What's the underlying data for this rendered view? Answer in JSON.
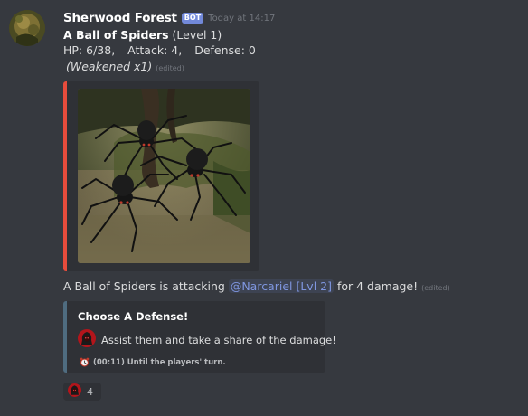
{
  "message": {
    "username": "Sherwood Forest",
    "bot_tag": "BOT",
    "timestamp": "Today at 14:17",
    "enemy_name": "A Ball of Spiders",
    "enemy_level": "(Level 1)",
    "hp": "HP: 6/38,",
    "attack": "Attack: 4,",
    "defense": "Defense: 0",
    "status": "(Weakened x1)",
    "edited_label": "(edited)",
    "attack_prefix": "A Ball of Spiders is attacking",
    "mention": "@Narcariel [Lvl 2]",
    "attack_suffix": "for 4 damage!",
    "edited_label_2": "(edited)"
  },
  "embed_image": {
    "accent_color": "#e74c3c",
    "image_subject": "spiders-in-forest"
  },
  "embed_defense": {
    "accent_color": "#4f6c80",
    "title": "Choose A Defense!",
    "option_icon": "hooded-figure-icon",
    "option_text": "Assist them and take a share of the damage!",
    "footer_icon": "alarm-clock-icon",
    "footer_text": "(00:11) Until the players' turn."
  },
  "reaction": {
    "icon": "hooded-figure-icon",
    "count": "4"
  }
}
